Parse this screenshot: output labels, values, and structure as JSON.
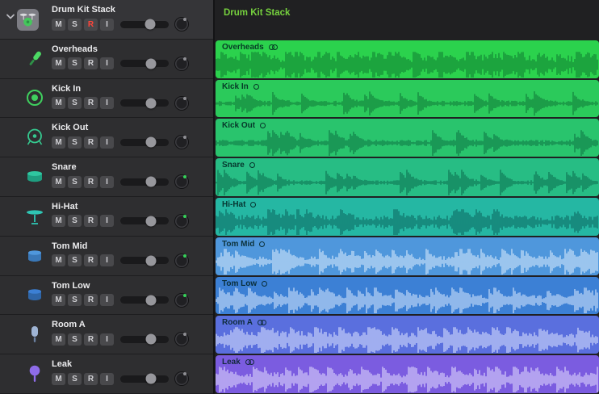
{
  "stack": {
    "name": "Drum Kit Stack",
    "region_label": "Drum Kit Stack",
    "label_color": "#76d13e",
    "record_armed": true,
    "volume": 0.62,
    "pan": "#8f8f94"
  },
  "controls": {
    "mute": "M",
    "solo": "S",
    "record": "R",
    "input": "I"
  },
  "tracks": [
    {
      "name": "Overheads",
      "stereo": true,
      "color": "#2bd24d",
      "wave": "rgba(6,92,40,0.6)",
      "pan": "#8f8f94",
      "volume": 0.63
    },
    {
      "name": "Kick In",
      "stereo": false,
      "color": "#2bca5b",
      "wave": "rgba(5,88,44,0.6)",
      "pan": "#8f8f94",
      "volume": 0.63
    },
    {
      "name": "Kick Out",
      "stereo": false,
      "color": "#29c46d",
      "wave": "rgba(4,84,52,0.6)",
      "pan": "#8f8f94",
      "volume": 0.63
    },
    {
      "name": "Snare",
      "stereo": false,
      "color": "#27bd84",
      "wave": "rgba(3,78,58,0.6)",
      "pan": "#35d158",
      "volume": 0.63
    },
    {
      "name": "Hi-Hat",
      "stereo": false,
      "color": "#25b7a3",
      "wave": "rgba(3,72,68,0.6)",
      "pan": "#35d158",
      "volume": 0.63
    },
    {
      "name": "Tom Mid",
      "stereo": false,
      "color": "#4f97dc",
      "wave": "rgba(225,240,255,0.8)",
      "pan": "#35d158",
      "volume": 0.63
    },
    {
      "name": "Tom Low",
      "stereo": false,
      "color": "#3c80d5",
      "wave": "rgba(222,236,255,0.8)",
      "pan": "#35d158",
      "volume": 0.63
    },
    {
      "name": "Room A",
      "stereo": true,
      "color": "#5a6fde",
      "wave": "rgba(226,233,255,0.8)",
      "pan": "#8f8f94",
      "volume": 0.63
    },
    {
      "name": "Leak",
      "stereo": true,
      "color": "#7b5ce0",
      "wave": "rgba(232,228,255,0.8)",
      "pan": "#8f8f94",
      "volume": 0.63
    }
  ],
  "icons": {
    "disclosure": "chevron-down-icon",
    "stack": "drum-kit-icon",
    "track_icons": [
      "pencil-mic-icon",
      "kick-target-icon",
      "kick-drum-icon",
      "snare-drum-icon",
      "hihat-cymbal-icon",
      "tom-drum-icon",
      "tom-drum-icon",
      "condenser-mic-icon",
      "round-mic-icon"
    ],
    "region_mono": "mono-circle-icon",
    "region_stereo": "stereo-circles-icon"
  }
}
